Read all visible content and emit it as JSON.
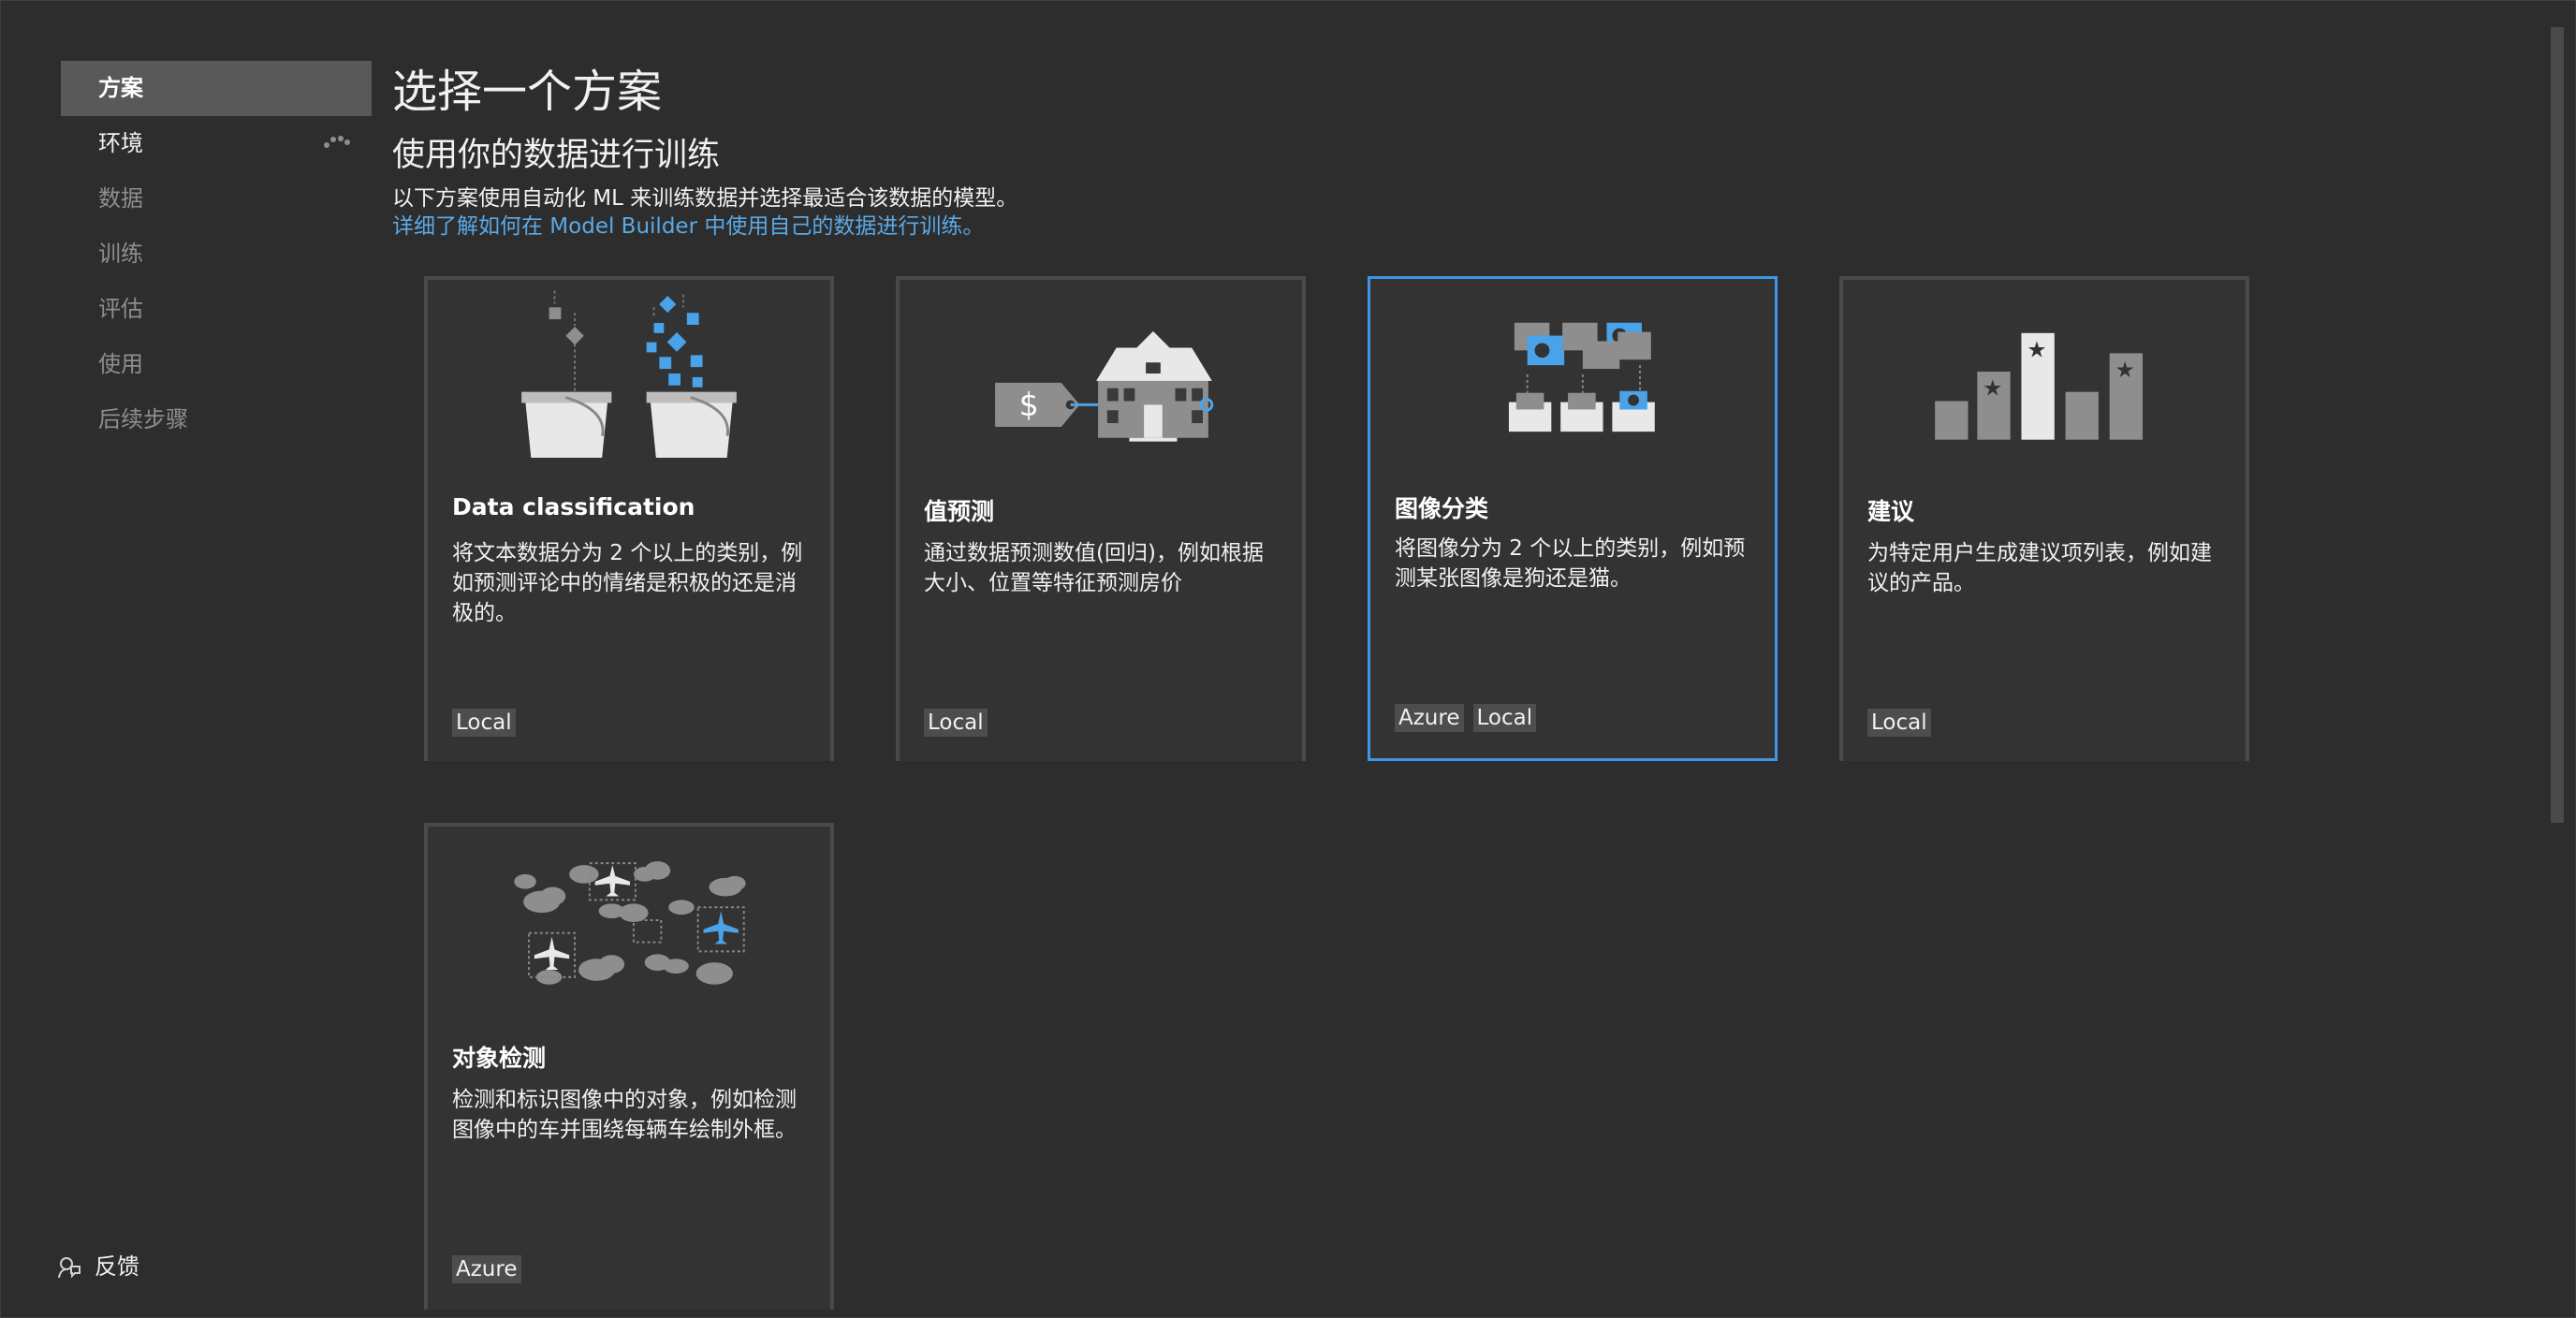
{
  "sidebar": {
    "items": [
      {
        "label": "方案",
        "state": "active"
      },
      {
        "label": "环境",
        "state": "enabled"
      },
      {
        "label": "数据",
        "state": "disabled"
      },
      {
        "label": "训练",
        "state": "disabled"
      },
      {
        "label": "评估",
        "state": "disabled"
      },
      {
        "label": "使用",
        "state": "disabled"
      },
      {
        "label": "后续步骤",
        "state": "disabled"
      }
    ],
    "feedback_label": "反馈"
  },
  "main": {
    "title": "选择一个方案",
    "subtitle": "使用你的数据进行训练",
    "description": "以下方案使用自动化 ML 来训练数据并选择最适合该数据的模型。",
    "link": "详细了解如何在 Model Builder 中使用自己的数据进行训练。"
  },
  "cards": [
    {
      "title": "Data classification",
      "body": "将文本数据分为 2 个以上的类别，例如预测评论中的情绪是积极的还是消极的。",
      "tags": [
        "Local"
      ],
      "icon": "buckets-icon"
    },
    {
      "title": "值预测",
      "body": "通过数据预测数值(回归)，例如根据大小、位置等特征预测房价",
      "tags": [
        "Local"
      ],
      "icon": "house-price-icon"
    },
    {
      "title": "图像分类",
      "body": "将图像分为 2 个以上的类别，例如预测某张图像是狗还是猫。",
      "tags": [
        "Azure",
        "Local"
      ],
      "icon": "image-sort-icon",
      "selected": true
    },
    {
      "title": "建议",
      "body": "为特定用户生成建议项列表，例如建议的产品。",
      "tags": [
        "Local"
      ],
      "icon": "bar-stars-icon"
    },
    {
      "title": "对象检测",
      "body": "检测和标识图像中的对象，例如检测图像中的车并围绕每辆车绘制外框。",
      "tags": [
        "Azure"
      ],
      "icon": "airplanes-clouds-icon"
    }
  ],
  "colors": {
    "background": "#2d2d2d",
    "card": "#333333",
    "accent": "#3e95e6",
    "link": "#5aa9e6"
  }
}
